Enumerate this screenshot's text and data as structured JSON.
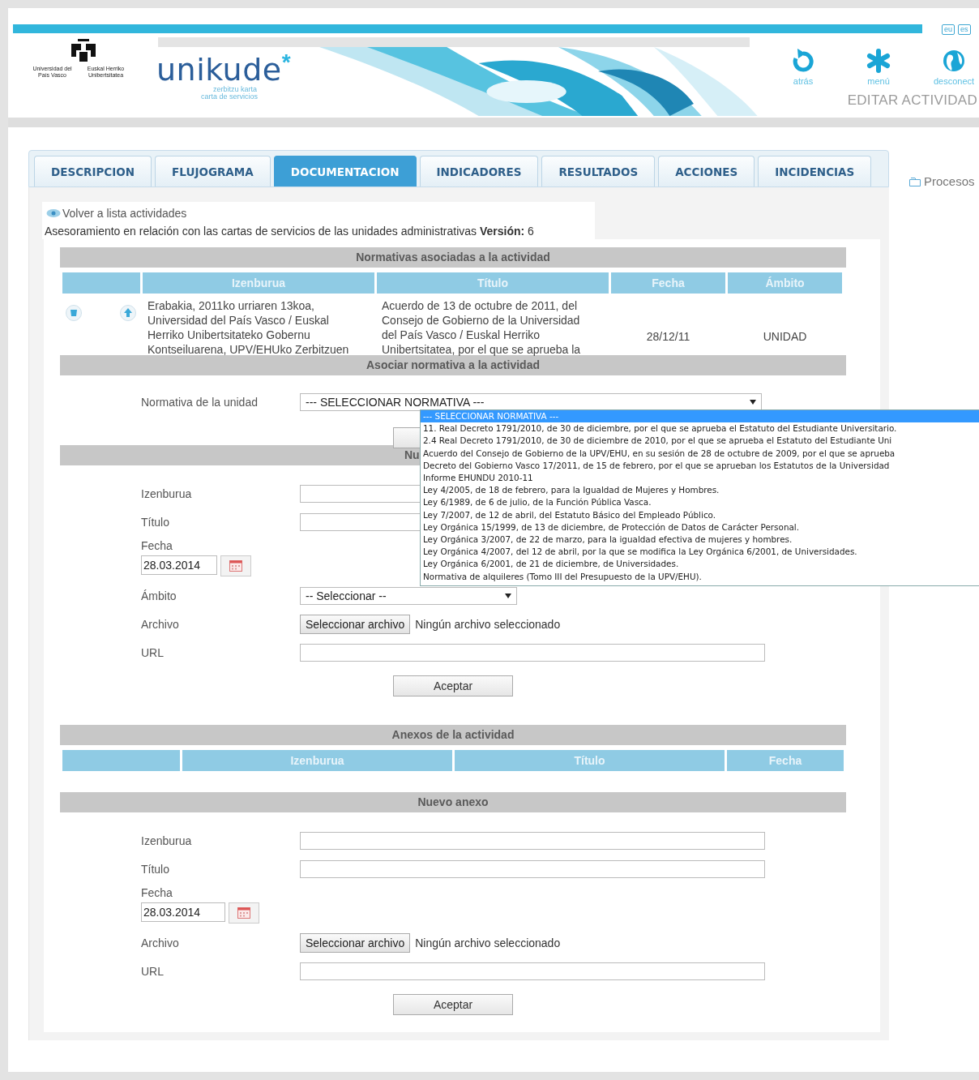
{
  "header": {
    "university": [
      "Universidad del País Vasco",
      "Euskal Herriko Unibertsitatea"
    ],
    "brand": {
      "name": "unikude",
      "mark": "*",
      "tagline": [
        "zerbitzu karta",
        "carta de servicios"
      ]
    },
    "languages": [
      "eu",
      "es"
    ],
    "nav": [
      {
        "kind": "back",
        "label": "atrás"
      },
      {
        "kind": "menu",
        "label": "menú"
      },
      {
        "kind": "globe",
        "label": "desconect"
      }
    ],
    "page_title": "EDITAR ACTIVIDAD"
  },
  "tabs": [
    {
      "label": "DESCRIPCION",
      "selected": false
    },
    {
      "label": "FLUJOGRAMA",
      "selected": false
    },
    {
      "label": "DOCUMENTACION",
      "selected": true
    },
    {
      "label": "INDICADORES",
      "selected": false
    },
    {
      "label": "RESULTADOS",
      "selected": false
    },
    {
      "label": "ACCIONES",
      "selected": false
    },
    {
      "label": "INCIDENCIAS",
      "selected": false
    }
  ],
  "sidebar": {
    "label": "Procesos"
  },
  "back_link": "Volver a lista actividades",
  "activity": {
    "text": "Asesoramiento en relación con las cartas de servicios de las unidades administrativas **Versión:**  6"
  },
  "normativas": {
    "title": "Normativas asociadas a la actividad",
    "columns": [
      "Izenburua",
      "Título",
      "Fecha",
      "Ámbito"
    ],
    "rows": [
      {
        "izenburua": "Erabakia, 2011ko urriaren 13koa, Universidad del País Vasco / Euskal Herriko Unibertsitateko Gobernu Kontseiluarena, UPV/EHUko Zerbitzuen",
        "titulo": "Acuerdo de 13 de octubre de 2011, del Consejo de Gobierno de la Universidad del País Vasco / Euskal Herriko Unibertsitatea, por el que se aprueba la",
        "fecha": "28/12/11",
        "ambito": "UNIDAD"
      }
    ]
  },
  "asociar": {
    "title": "Asociar normativa a la actividad",
    "label": "Normativa de la unidad",
    "value": "--- SELECCIONAR NORMATIVA ---",
    "open": true,
    "options": [
      {
        "label": "--- SELECCIONAR NORMATIVA ---",
        "selected": true
      },
      {
        "label": "11. Real Decreto 1791/2010, de 30 de diciembre, por el que se aprueba el Estatuto del Estudiante Universitario.",
        "selected": false
      },
      {
        "label": "2.4 Real Decreto 1791/2010, de 30 de diciembre de 2010, por el que se aprueba el Estatuto del Estudiante Uni",
        "selected": false
      },
      {
        "label": "Acuerdo del Consejo de Gobierno de la UPV/EHU, en su sesión de 28 de octubre de 2009, por el que se aprueba",
        "selected": false
      },
      {
        "label": "Decreto del Gobierno Vasco 17/2011, de 15 de febrero, por el que se aprueban los Estatutos de la Universidad",
        "selected": false
      },
      {
        "label": "Informe EHUNDU 2010-11",
        "selected": false
      },
      {
        "label": "Ley 4/2005, de 18 de febrero, para la Igualdad de Mujeres y Hombres.",
        "selected": false
      },
      {
        "label": "Ley 6/1989, de 6 de julio, de la Función Pública Vasca.",
        "selected": false
      },
      {
        "label": "Ley 7/2007, de 12 de abril, del Estatuto Básico del Empleado Público.",
        "selected": false
      },
      {
        "label": "Ley Orgánica 15/1999, de 13 de diciembre, de Protección de Datos de Carácter Personal.",
        "selected": false
      },
      {
        "label": "Ley Orgánica 3/2007, de 22 de marzo, para la igualdad efectiva de mujeres y hombres.",
        "selected": false
      },
      {
        "label": "Ley Orgánica 4/2007, del 12 de abril, por la que se modifica la Ley Orgánica 6/2001, de Universidades.",
        "selected": false
      },
      {
        "label": "Ley Orgánica 6/2001, de 21 de diciembre, de Universidades.",
        "selected": false
      },
      {
        "label": "Normativa de alquileres (Tomo III del Presupuesto de la UPV/EHU).",
        "selected": false
      }
    ]
  },
  "nueva": {
    "title": "Nu",
    "fields": [
      {
        "kind": "text",
        "label": "Izenburua"
      },
      {
        "kind": "text",
        "label": "Título"
      },
      {
        "kind": "date",
        "label": "Fecha",
        "value": "28.03.2014"
      },
      {
        "kind": "select",
        "label": "Ámbito",
        "value": "-- Seleccionar --"
      },
      {
        "kind": "file",
        "label": "Archivo",
        "button": "Seleccionar archivo",
        "status": "Ningún archivo seleccionado"
      },
      {
        "kind": "text",
        "label": "URL"
      }
    ],
    "submit": "Aceptar"
  },
  "anexos": {
    "title": "Anexos de la actividad",
    "columns": [
      "Izenburua",
      "Título",
      "Fecha"
    ]
  },
  "nuevo_anexo": {
    "title": "Nuevo anexo",
    "fields": [
      {
        "kind": "text",
        "label": "Izenburua"
      },
      {
        "kind": "text",
        "label": "Título"
      },
      {
        "kind": "date",
        "label": "Fecha",
        "value": "28.03.2014"
      },
      {
        "kind": "file",
        "label": "Archivo",
        "button": "Seleccionar archivo",
        "status": "Ningún archivo seleccionado"
      },
      {
        "kind": "text",
        "label": "URL"
      }
    ],
    "submit": "Aceptar"
  }
}
